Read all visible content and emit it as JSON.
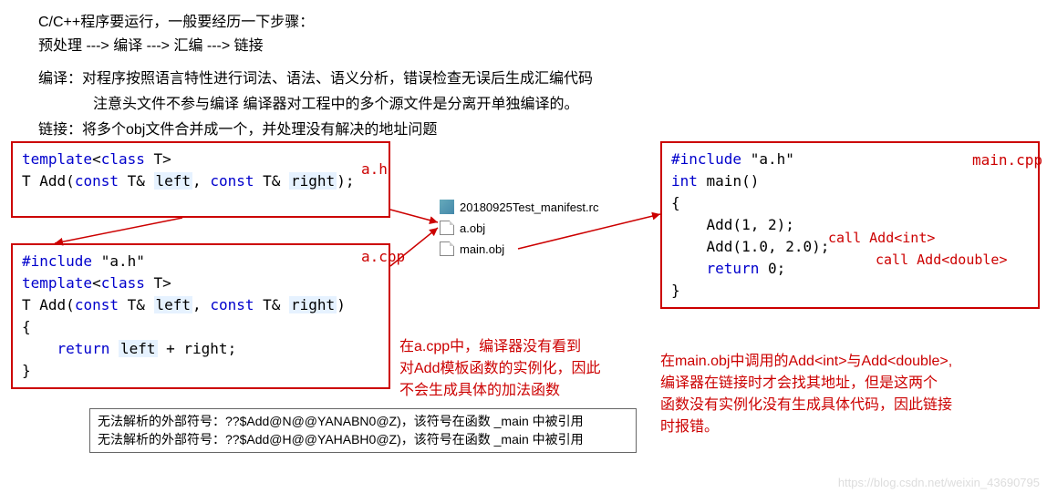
{
  "intro": {
    "line1": "C/C++程序要运行，一般要经历一下步骤：",
    "line2": "预处理 ---> 编译 ---> 汇编 ---> 链接",
    "line3": "编译：对程序按照语言特性进行词法、语法、语义分析，错误检查无误后生成汇编代码",
    "line4": "注意头文件不参与编译  编译器对工程中的多个源文件是分离开单独编译的。",
    "line5": "链接：将多个obj文件合并成一个，并处理没有解决的地址问题"
  },
  "ah": {
    "label": "a.h",
    "code": {
      "l1_a": "template",
      "l1_b": "<",
      "l1_c": "class",
      "l1_d": " T>",
      "l2_a": "T ",
      "l2_b": "Add",
      "l2_c": "(",
      "l2_d": "const",
      "l2_e": " T& ",
      "l2_left": "left",
      "l2_f": ", ",
      "l2_g": "const",
      "l2_h": " T& ",
      "l2_right": "right",
      "l2_i": ");"
    }
  },
  "acpp": {
    "label": "a.cpp",
    "code": {
      "l1_a": "#include",
      "l1_b": " \"a.h\"",
      "l2_a": "template",
      "l2_b": "<",
      "l2_c": "class",
      "l2_d": " T>",
      "l3_a": "T ",
      "l3_b": "Add",
      "l3_c": "(",
      "l3_d": "const",
      "l3_e": " T& ",
      "l3_left": "left",
      "l3_f": ", ",
      "l3_g": "const",
      "l3_h": " T& ",
      "l3_right": "right",
      "l3_i": ")",
      "l4": "{",
      "l5_a": "    return ",
      "l5_left": "left",
      "l5_b": " + right;",
      "l6": "}"
    }
  },
  "maincpp": {
    "label": "main.cpp",
    "code": {
      "l1_a": "#include",
      "l1_b": " \"a.h\"",
      "l2_a": "int",
      "l2_b": " main()",
      "l3": "{",
      "l4": "    Add(1, 2);",
      "l5": "    Add(1.0, 2.0);",
      "l6_a": "    return",
      "l6_b": " 0;",
      "l7": "}"
    },
    "comment1": "call Add<int>",
    "comment2": "call Add<double>"
  },
  "files": {
    "manifest": "20180925Test_manifest.rc",
    "aobj": "a.obj",
    "mainobj": "main.obj"
  },
  "notes": {
    "acpp_note_l1": "在a.cpp中，编译器没有看到",
    "acpp_note_l2": "对Add模板函数的实例化，因此",
    "acpp_note_l3": "不会生成具体的加法函数",
    "main_note_l1": "在main.obj中调用的Add<int>与Add<double>,",
    "main_note_l2": "编译器在链接时才会找其地址，但是这两个",
    "main_note_l3": "函数没有实例化没有生成具体代码，因此链接",
    "main_note_l4": "时报错。"
  },
  "errors": {
    "l1": "无法解析的外部符号：??$Add@N@@YANABN0@Z)，该符号在函数 _main 中被引用",
    "l2": "无法解析的外部符号：??$Add@H@@YAHABH0@Z)，该符号在函数 _main 中被引用"
  },
  "watermark": "https://blog.csdn.net/weixin_43690795"
}
